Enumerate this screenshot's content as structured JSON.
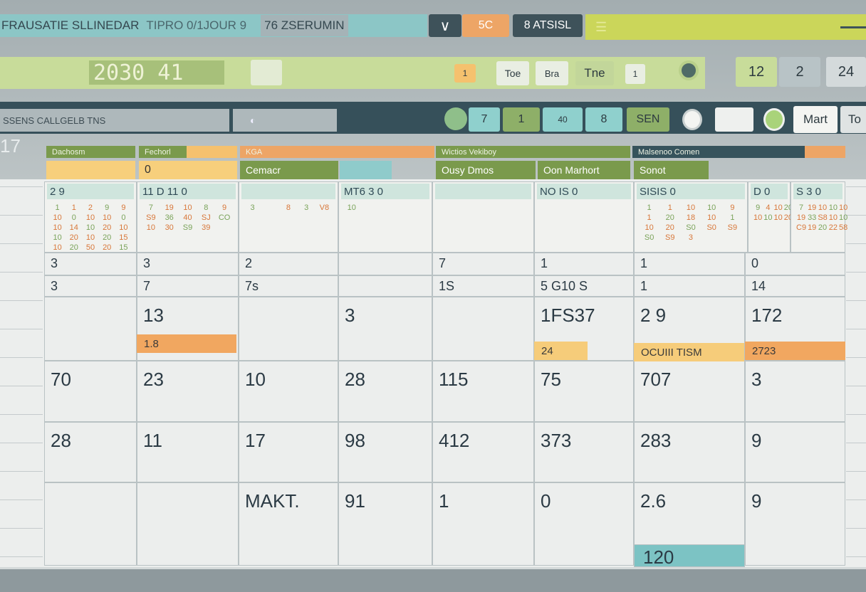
{
  "topbar": {
    "title": "FRAUSATIE SLLINEDAR",
    "segment2": "TIPRO 0/1JOUR 9",
    "segment3": "76 ZSERUMIN",
    "badge_orange": "5C",
    "badge_dark": "8 ATSISL"
  },
  "datebar": {
    "display": "2030 41",
    "tags": [
      "1",
      "Toe",
      "Bra",
      "Tne",
      "1"
    ],
    "right_buttons": [
      "12",
      "2",
      "24"
    ]
  },
  "toolbar": {
    "search_text": "SSENS  CALLGELB  TNS",
    "buttons": [
      "7",
      "1",
      "40",
      "8",
      "SEN"
    ],
    "view_label": "Mart",
    "today_label": "To"
  },
  "side_label": "17",
  "headers": [
    {
      "label": "Dachosm",
      "color": "#7a9a4c"
    },
    {
      "label": "Fechorl",
      "color": "#7a9a4c"
    },
    {
      "label": "",
      "color": "#f5c16e"
    },
    {
      "label": "KGA",
      "color": "#eda566"
    },
    {
      "label": "Wictios            Vekiboy",
      "color": "#7a9a4c"
    },
    {
      "label": "Malsenoo                    Comen",
      "color": "#36535c"
    },
    {
      "label": "",
      "color": "#eda566"
    }
  ],
  "subheaders": [
    {
      "label": "",
      "color": "#f7cf7c"
    },
    {
      "label": "0",
      "color": "#f7cf7c"
    },
    {
      "label": "Cemacr",
      "color": "#7a9a4c"
    },
    {
      "label": "",
      "color": "#8fcbcb"
    },
    {
      "label": "Ousy Dmos",
      "color": "#7a9a4c"
    },
    {
      "label": "Oon Marhort",
      "color": "#7a9a4c"
    },
    {
      "label": "Sonot",
      "color": "#7a9a4c"
    }
  ],
  "mini_headers": [
    "2   9",
    "11  D 11 0",
    "",
    "MT6  3  0",
    "",
    "NO  IS  0",
    "SISIS  0",
    "D  0",
    "S  3  0"
  ],
  "mini_days": [
    "1 1 2 9 9 10 0 10 10 0 10 14 10 20 10 10 20 10 20 15 10 20 50 20 15",
    "7 19 10 8 9 S9 36 40 SJ CO 10 30 S9 39",
    "3  8 3 V8",
    "10",
    "",
    "",
    "1 1 10 10 9 1 20 18 10 1 10 20 S0 S0 S9 S0 S9 3",
    "9 4 10 20 10 10 10 10 20 20",
    "7 19 10 10 10 19 33 S8 10 10 C9 19 20 22 58"
  ],
  "rows": [
    [
      {
        "t": "3",
        "c": "#7cc3c4"
      },
      {
        "t": "3",
        "c": "#c9d0d0"
      },
      {
        "t": "2",
        "c": "#e7ebe8"
      },
      {
        "t": "",
        "c": "#7cc3c4"
      },
      {
        "t": "7",
        "c": "#7cc3c4"
      },
      {
        "t": "1",
        "c": "#7cc3c4"
      },
      {
        "t": "1",
        "c": "#eceeed"
      },
      {
        "t": "0",
        "c": "#f5f4ee"
      }
    ],
    [
      {
        "t": "3",
        "c": "#7cc3c4"
      },
      {
        "t": "7",
        "c": "#d6e2c2"
      },
      {
        "t": "7s",
        "c": "#d4d8d6"
      },
      {
        "t": "",
        "c": "#f7f6ef"
      },
      {
        "t": "1S",
        "c": "#e1e6e3"
      },
      {
        "t": "5 G10 S",
        "c": "#e1e6e3"
      },
      {
        "t": "1",
        "c": "#f5f4ee"
      },
      {
        "t": "14",
        "c": "#f5f4ee"
      }
    ],
    [
      {
        "t": "",
        "c": "#8dcbc8"
      },
      {
        "t": "13",
        "c": "#66b9bb"
      },
      {
        "t": "",
        "c": "#d8a883"
      },
      {
        "t": "3",
        "c": "#f7f4e6"
      },
      {
        "t": "",
        "c": "#8dcbc8"
      },
      {
        "t": "1FS37",
        "c": "#f6cc7a"
      },
      {
        "t": "2 9",
        "c": "#7cc3c4"
      },
      {
        "t": "172",
        "c": "#f1a760"
      }
    ],
    [
      {
        "t": "70",
        "c": "#f7f4e6"
      },
      {
        "t": "23",
        "c": "#f7f4e6"
      },
      {
        "t": "10",
        "c": "#e6e9e6"
      },
      {
        "t": "28",
        "c": "#f7f4e6"
      },
      {
        "t": "115",
        "c": "#f7f4e6"
      },
      {
        "t": "75",
        "c": "#7cc3c4"
      },
      {
        "t": "707",
        "c": "#f6cc7a"
      },
      {
        "t": "3",
        "c": "#f6cc7a"
      }
    ],
    [
      {
        "t": "28",
        "c": "#f7f4e6"
      },
      {
        "t": "11",
        "c": "#f1a760"
      },
      {
        "t": "17",
        "c": "#ebeee9"
      },
      {
        "t": "98",
        "c": "#f1a760"
      },
      {
        "t": "412",
        "c": "#f7f4e6"
      },
      {
        "t": "373",
        "c": "#dde6cc"
      },
      {
        "t": "283",
        "c": "#7cc3c4"
      },
      {
        "t": "9",
        "c": "#f1a760"
      }
    ],
    [
      {
        "t": "",
        "c": "#f7f4e6"
      },
      {
        "t": "",
        "c": "#dde6cc"
      },
      {
        "t": "MAKT.",
        "c": "#dde6cc"
      },
      {
        "t": "91",
        "c": "#8dcbc8"
      },
      {
        "t": "1",
        "c": "#e6e9e6"
      },
      {
        "t": "0",
        "c": "#e6e9e6"
      },
      {
        "t": "2.6",
        "c": "#f6cc7a"
      },
      {
        "t": "9",
        "c": "#e6e9e6"
      }
    ]
  ],
  "extra_cell": "120",
  "row5_sub": [
    "1.8",
    "24",
    "OCUIII TISM",
    "2723"
  ]
}
